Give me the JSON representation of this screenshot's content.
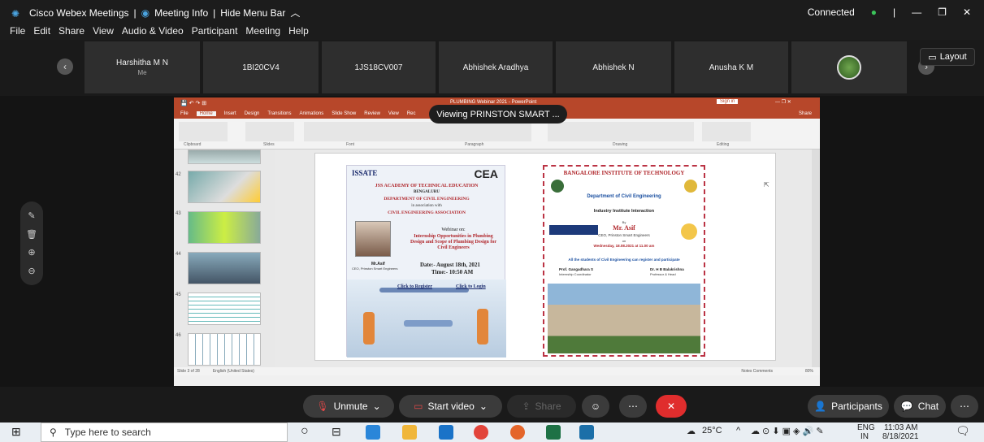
{
  "titlebar": {
    "app": "Cisco Webex Meetings",
    "sep1": "|",
    "meeting_info": "Meeting Info",
    "sep2": "|",
    "hide_menu": "Hide Menu Bar",
    "status": "Connected"
  },
  "menu": [
    "File",
    "Edit",
    "Share",
    "View",
    "Audio & Video",
    "Participant",
    "Meeting",
    "Help"
  ],
  "participants": [
    {
      "name": "Harshitha M N",
      "sub": "Me"
    },
    {
      "name": "1BI20CV4",
      "sub": ""
    },
    {
      "name": "1JS18CV007",
      "sub": ""
    },
    {
      "name": "Abhishek Aradhya",
      "sub": ""
    },
    {
      "name": "Abhishek N",
      "sub": ""
    },
    {
      "name": "Anusha K M",
      "sub": ""
    }
  ],
  "layout_label": "Layout",
  "viewing_banner": "Viewing PRINSTON SMART ...",
  "ppt": {
    "window_title": "PLUMBING Webinar 2021 - PowerPoint",
    "sign_in": "Sign in",
    "tabs": [
      "File",
      "Home",
      "Insert",
      "Design",
      "Transitions",
      "Animations",
      "Slide Show",
      "Review",
      "View",
      "Rec"
    ],
    "share": "Share",
    "ribbon_groups": [
      "Clipboard",
      "Slides",
      "Font",
      "Paragraph",
      "Drawing",
      "Editing"
    ],
    "thumb_numbers": [
      "42",
      "43",
      "44",
      "45",
      "46"
    ],
    "status_left": "Slide 3 of 28",
    "status_lang": "English (United States)",
    "status_right": "Notes   Comments",
    "zoom": "80%"
  },
  "poster1": {
    "logo": "ISSATE",
    "logo_cea": "CEA",
    "college": "JSS ACADEMY OF TECHNICAL EDUCATION",
    "city": "BENGALURU",
    "dept": "DEPARTMENT OF CIVIL ENGINEERING",
    "assoc1": "in association with",
    "assoc2": "CIVIL ENGINEERING ASSOCIATION",
    "webinar": "Webinar on:",
    "topic": "Internship Opportunities in Plumbing Design and Scope of Plumbing Design for Civil Engineers",
    "speaker": "Mr.Asif",
    "speaker_role": "CEO, Prinston Smart Engineers",
    "date": "Date:- August 18th, 2021",
    "time": "Time:- 10:50 AM",
    "register": "Click to Register",
    "login": "Click to Login"
  },
  "poster2": {
    "college": "BANGALORE INSTITUTE OF TECHNOLOGY",
    "dept": "Department of Civil Engineering",
    "event": "Industry Institute Interaction",
    "by": "By",
    "speaker": "Mr. Asif",
    "speaker_role": "CEO, Prinston Smart Engineers",
    "on": "on",
    "date": "Wednesday, 18.08.2021 at 11.00 am",
    "note": "All the students of Civil Engineering can register and participate",
    "coord1": "Prof. Gangadhara S",
    "coord1_role": "Internship Coordinator",
    "coord2": "Dr. H B Balakrishna",
    "coord2_role": "Professor & Head"
  },
  "controls": {
    "unmute": "Unmute",
    "start_video": "Start video",
    "share": "Share",
    "participants": "Participants",
    "chat": "Chat"
  },
  "taskbar": {
    "search_placeholder": "Type here to search",
    "temp": "25°C",
    "lang": "ENG",
    "lang_sub": "IN",
    "time": "11:03 AM",
    "date": "8/18/2021"
  }
}
